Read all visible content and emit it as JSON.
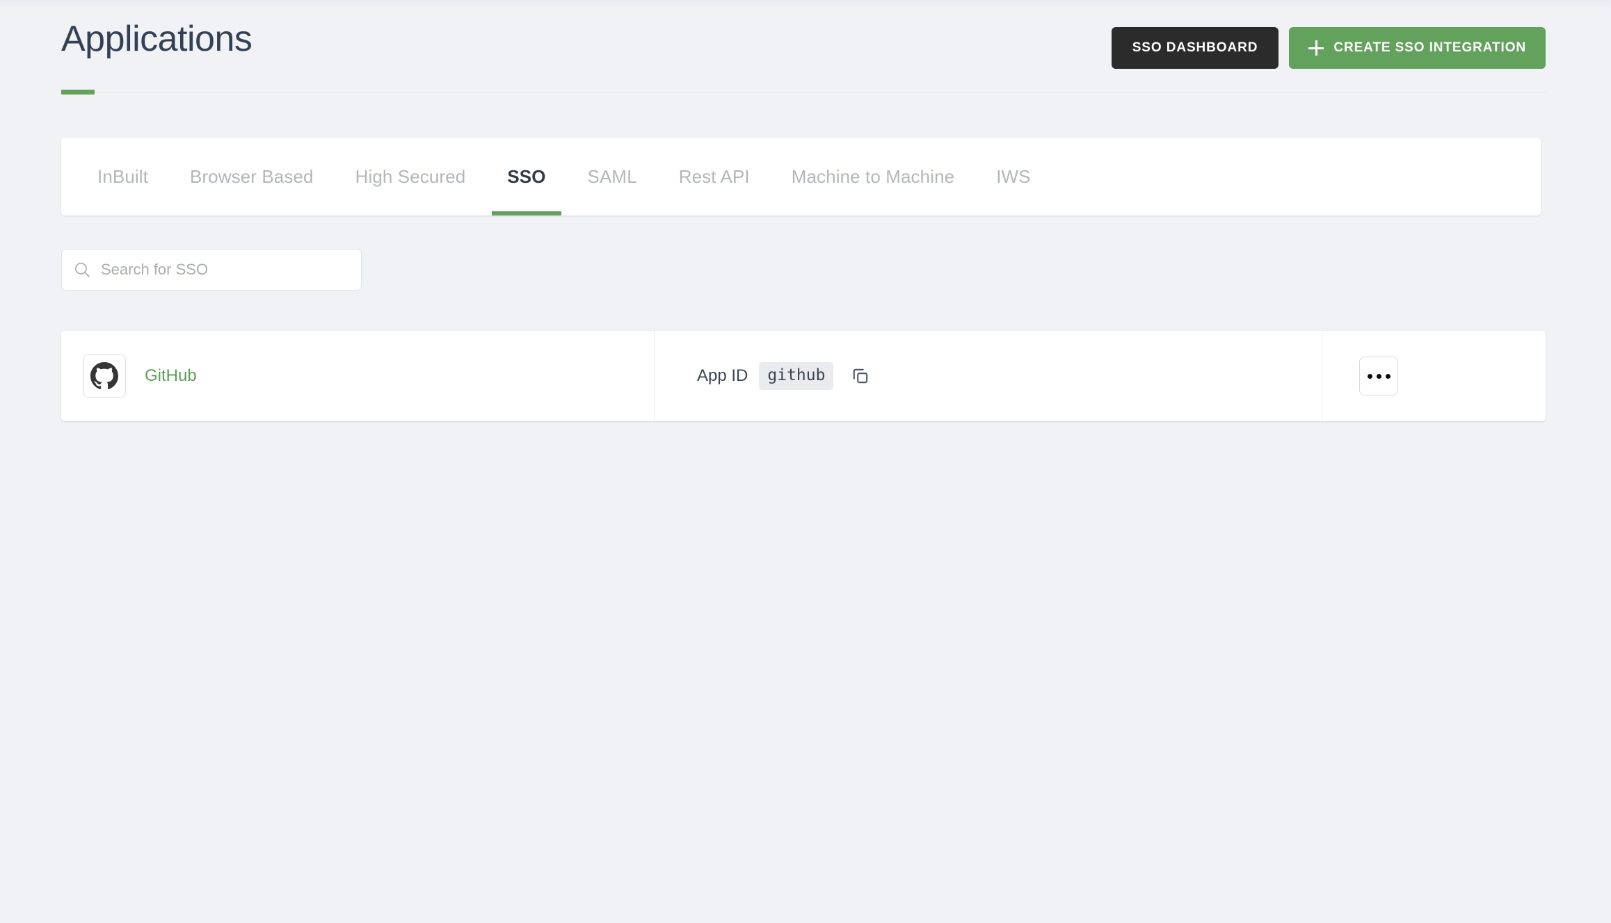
{
  "page": {
    "title": "Applications",
    "accent_color": "#62a25c",
    "background_color": "#f1f2f6",
    "title_color": "#344054"
  },
  "header": {
    "actions": [
      {
        "label": "SSO DASHBOARD",
        "style": "dark",
        "icon": null
      },
      {
        "label": "CREATE SSO INTEGRATION",
        "style": "green",
        "icon": "plus-icon"
      }
    ]
  },
  "tabs": {
    "active_index": 3,
    "items": [
      {
        "label": "InBuilt"
      },
      {
        "label": "Browser Based"
      },
      {
        "label": "High Secured"
      },
      {
        "label": "SSO"
      },
      {
        "label": "SAML"
      },
      {
        "label": "Rest API"
      },
      {
        "label": "Machine to Machine"
      },
      {
        "label": "IWS"
      }
    ]
  },
  "search": {
    "placeholder": "Search for SSO",
    "value": "",
    "icon": "search-icon"
  },
  "table": {
    "rows": [
      {
        "logo": "github-icon",
        "name": "GitHub",
        "name_color": "#5aa055",
        "appid_label": "App ID",
        "appid_value": "github",
        "copy_icon": "copy-icon",
        "menu_icon": "ellipsis-icon"
      }
    ]
  }
}
